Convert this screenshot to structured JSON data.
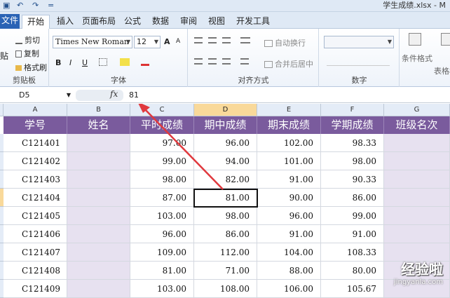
{
  "window": {
    "title": "学生成绩.xlsx - M",
    "quick_access": [
      "▣",
      "↶",
      "↷",
      "="
    ]
  },
  "tabs": [
    "文件",
    "开始",
    "插入",
    "页面布局",
    "公式",
    "数据",
    "审阅",
    "视图",
    "开发工具"
  ],
  "ribbon": {
    "clipboard": {
      "paste": "贴",
      "cut": "剪切",
      "copy": "复制",
      "painter": "格式刷",
      "label": "剪贴板"
    },
    "font": {
      "name": "Times New Roman",
      "size": "12",
      "grow": "A",
      "shrink": "A",
      "bold": "B",
      "italic": "I",
      "underline": "U",
      "label": "字体"
    },
    "alignment": {
      "wrap": "自动换行",
      "merge": "合并后居中",
      "label": "对齐方式"
    },
    "number": {
      "label": "数字"
    },
    "styles": {
      "conditional": "条件格式",
      "table": "表格格"
    }
  },
  "formula_bar": {
    "name_box": "D5",
    "fx": "fx",
    "value": "81"
  },
  "columns": [
    "A",
    "B",
    "C",
    "D",
    "E",
    "F",
    "G"
  ],
  "headers": [
    "学号",
    "姓名",
    "平时成绩",
    "期中成绩",
    "期末成绩",
    "学期成绩",
    "班级名次"
  ],
  "rows": [
    [
      "C121401",
      "",
      "97.00",
      "96.00",
      "102.00",
      "98.33",
      ""
    ],
    [
      "C121402",
      "",
      "99.00",
      "94.00",
      "101.00",
      "98.00",
      ""
    ],
    [
      "C121403",
      "",
      "98.00",
      "82.00",
      "91.00",
      "90.33",
      ""
    ],
    [
      "C121404",
      "",
      "87.00",
      "81.00",
      "90.00",
      "86.00",
      ""
    ],
    [
      "C121405",
      "",
      "103.00",
      "98.00",
      "96.00",
      "99.00",
      ""
    ],
    [
      "C121406",
      "",
      "96.00",
      "86.00",
      "91.00",
      "91.00",
      ""
    ],
    [
      "C121407",
      "",
      "109.00",
      "112.00",
      "104.00",
      "108.33",
      ""
    ],
    [
      "C121408",
      "",
      "81.00",
      "71.00",
      "88.00",
      "80.00",
      ""
    ],
    [
      "C121409",
      "",
      "103.00",
      "108.00",
      "106.00",
      "105.67",
      ""
    ]
  ],
  "watermark": {
    "line1": "经验啦",
    "line2": "jingyanla.com"
  },
  "colors": {
    "header_fill": "#7a5b9d",
    "mauve_fill": "#e7e1f0",
    "arrow": "#e0393e",
    "accent": "#2a63b5"
  }
}
